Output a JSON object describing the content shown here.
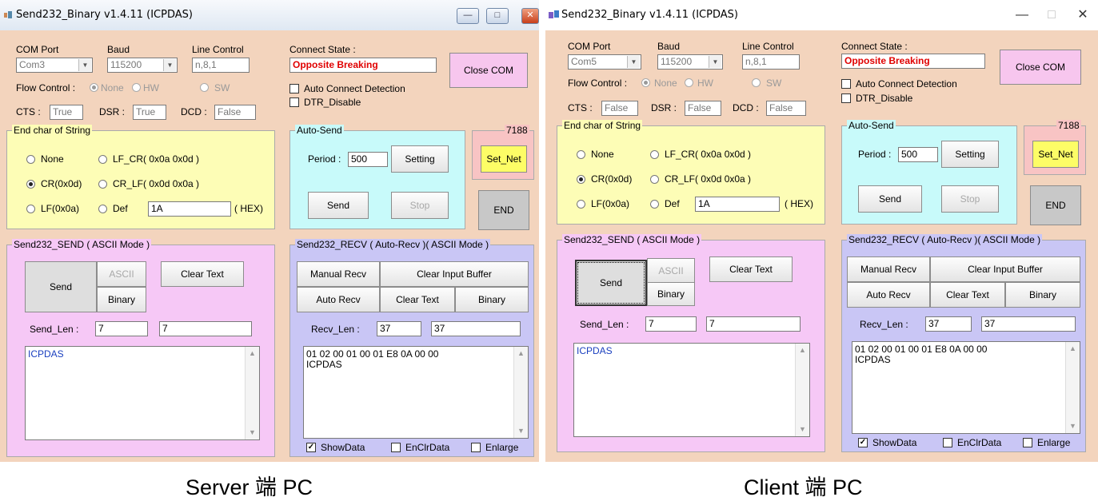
{
  "windows": [
    {
      "title": "Send232_Binary v1.4.11 (ICPDAS)",
      "com_label": "COM Port",
      "com_value": "Com3",
      "baud_label": "Baud",
      "baud_value": "115200",
      "line_label": "Line Control",
      "line_value": "n,8,1",
      "flow_label": "Flow Control :",
      "flow_none": "None",
      "flow_hw": "HW",
      "flow_sw": "SW",
      "cts_label": "CTS :",
      "cts_value": "True",
      "dsr_label": "DSR :",
      "dsr_value": "True",
      "dcd_label": "DCD :",
      "dcd_value": "False",
      "connect_label": "Connect State :",
      "connect_value": "Opposite Breaking",
      "close_com": "Close COM",
      "auto_connect": "Auto Connect Detection",
      "dtr_disable": "DTR_Disable",
      "endchar_legend": "End char of String",
      "opt_none": "None",
      "opt_lfcr": "LF_CR( 0x0a 0x0d )",
      "opt_cr": "CR(0x0d)",
      "opt_crlf": "CR_LF( 0x0d 0x0a )",
      "opt_lf": "LF(0x0a)",
      "opt_def": "Def",
      "def_value": "1A",
      "hex_label": "( HEX)",
      "autosend_legend": "Auto-Send",
      "period_label": "Period :",
      "period_value": "500",
      "setting": "Setting",
      "send": "Send",
      "stop": "Stop",
      "n7188_legend": "7188",
      "set_net": "Set_Net",
      "end": "END",
      "send_legend": "Send232_SEND ( ASCII Mode )",
      "send_btn": "Send",
      "ascii_btn": "ASCII",
      "binary_btn": "Binary",
      "clear_text": "Clear Text",
      "send_len_label": "Send_Len :",
      "send_len_1": "7",
      "send_len_2": "7",
      "send_text": "ICPDAS",
      "recv_legend": "Send232_RECV ( Auto-Recv )( ASCII Mode )",
      "manual_recv": "Manual Recv",
      "clear_input": "Clear Input Buffer",
      "auto_recv": "Auto Recv",
      "recv_clear_text": "Clear Text",
      "recv_binary": "Binary",
      "recv_len_label": "Recv_Len :",
      "recv_len_1": "37",
      "recv_len_2": "37",
      "recv_line1": "01 02 00 01 00 01 E8 0A 00 00",
      "recv_line2": "ICPDAS",
      "show_data": "ShowData",
      "enclr_data": "EnClrData",
      "enlarge": "Enlarge",
      "caption": "Server 端 PC"
    },
    {
      "title": "Send232_Binary v1.4.11 (ICPDAS)",
      "com_label": "COM Port",
      "com_value": "Com5",
      "baud_label": "Baud",
      "baud_value": "115200",
      "line_label": "Line Control",
      "line_value": "n,8,1",
      "flow_label": "Flow Control :",
      "flow_none": "None",
      "flow_hw": "HW",
      "flow_sw": "SW",
      "cts_label": "CTS :",
      "cts_value": "False",
      "dsr_label": "DSR :",
      "dsr_value": "False",
      "dcd_label": "DCD :",
      "dcd_value": "False",
      "connect_label": "Connect State :",
      "connect_value": "Opposite Breaking",
      "close_com": "Close COM",
      "auto_connect": "Auto Connect Detection",
      "dtr_disable": "DTR_Disable",
      "endchar_legend": "End char of String",
      "opt_none": "None",
      "opt_lfcr": "LF_CR( 0x0a 0x0d )",
      "opt_cr": "CR(0x0d)",
      "opt_crlf": "CR_LF( 0x0d 0x0a )",
      "opt_lf": "LF(0x0a)",
      "opt_def": "Def",
      "def_value": "1A",
      "hex_label": "( HEX)",
      "autosend_legend": "Auto-Send",
      "period_label": "Period :",
      "period_value": "500",
      "setting": "Setting",
      "send": "Send",
      "stop": "Stop",
      "n7188_legend": "7188",
      "set_net": "Set_Net",
      "end": "END",
      "send_legend": "Send232_SEND ( ASCII Mode )",
      "send_btn": "Send",
      "ascii_btn": "ASCII",
      "binary_btn": "Binary",
      "clear_text": "Clear Text",
      "send_len_label": "Send_Len :",
      "send_len_1": "7",
      "send_len_2": "7",
      "send_text": "ICPDAS",
      "recv_legend": "Send232_RECV ( Auto-Recv )( ASCII Mode )",
      "manual_recv": "Manual Recv",
      "clear_input": "Clear Input Buffer",
      "auto_recv": "Auto Recv",
      "recv_clear_text": "Clear Text",
      "recv_binary": "Binary",
      "recv_len_label": "Recv_Len :",
      "recv_len_1": "37",
      "recv_len_2": "37",
      "recv_line1": "01 02 00 01 00 01 E8 0A 00 00",
      "recv_line2": "ICPDAS",
      "show_data": "ShowData",
      "enclr_data": "EnClrData",
      "enlarge": "Enlarge",
      "caption": "Client 端 PC"
    }
  ],
  "titlebar_buttons": {
    "minimize": "—",
    "maximize": "□",
    "close": "✕"
  },
  "colors": {
    "window_bg": "#f3d4bd",
    "endchar_bg": "#fdfdb6",
    "autosend_bg": "#c8fafa",
    "n7188_bg": "#f8c4c4",
    "send_bg": "#f6c8f6",
    "recv_bg": "#c9c6f5",
    "state_text": "#e00000",
    "send_text": "#1a3fbf",
    "set_net": "#fdfd66"
  }
}
